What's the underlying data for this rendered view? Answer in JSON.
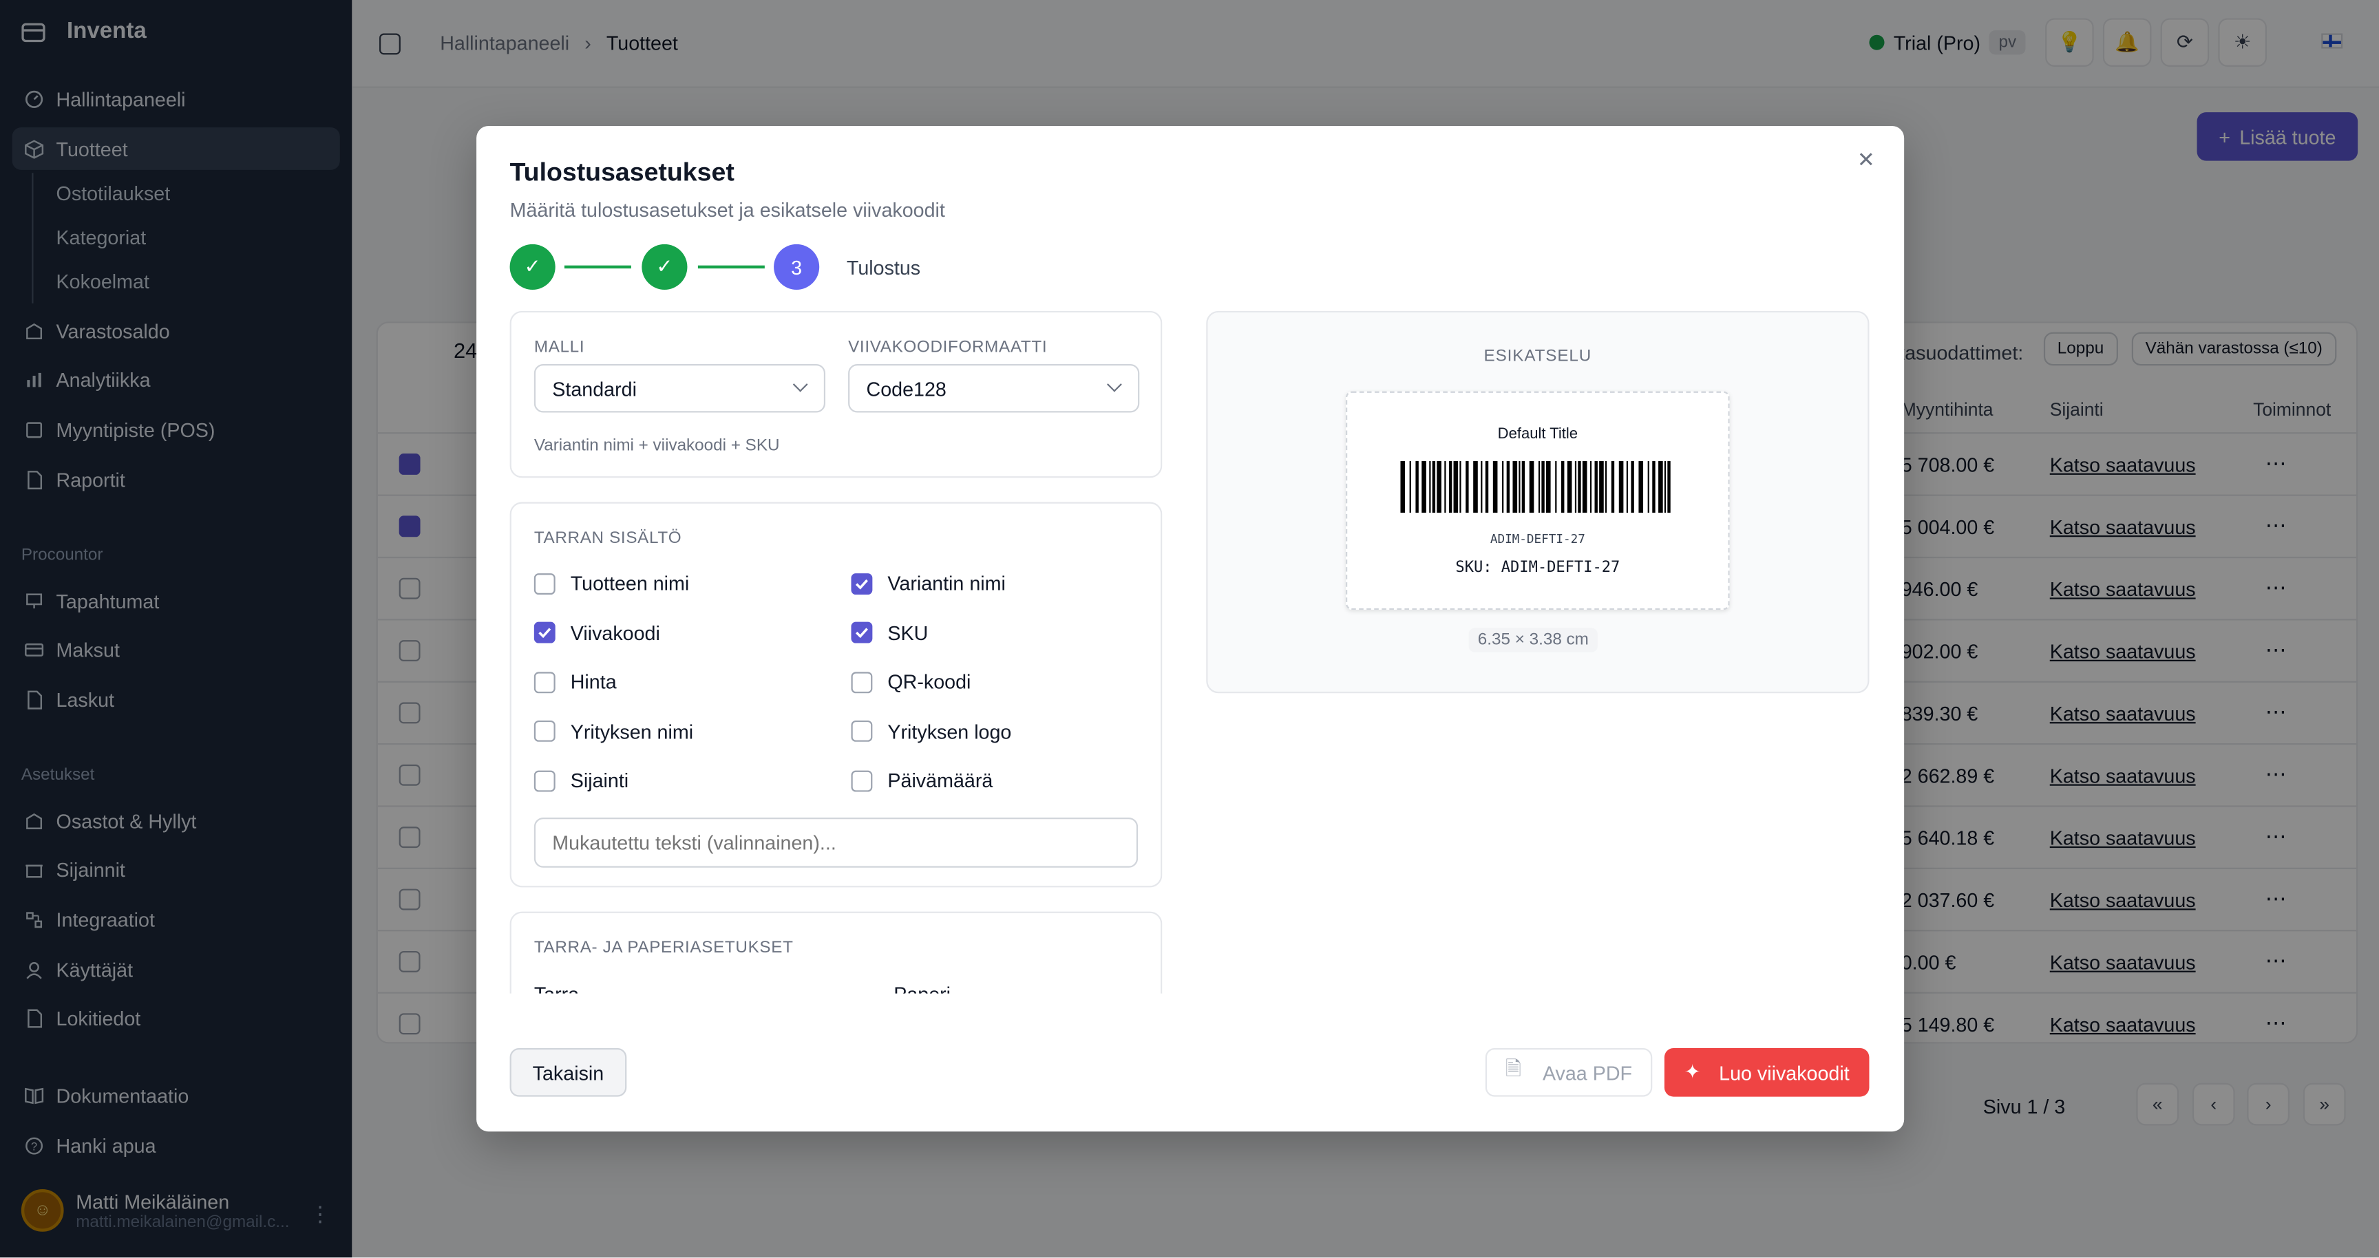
{
  "app": {
    "name": "Inventa"
  },
  "sidebar": {
    "items": [
      {
        "label": "Hallintapaneeli"
      },
      {
        "label": "Tuotteet"
      },
      {
        "label": "Varastosaldo"
      },
      {
        "label": "Analytiikka"
      },
      {
        "label": "Myyntipiste (POS)"
      },
      {
        "label": "Raportit"
      }
    ],
    "subitems": [
      {
        "label": "Ostotilaukset"
      },
      {
        "label": "Kategoriat"
      },
      {
        "label": "Kokoelmat"
      }
    ],
    "groups": [
      {
        "title": "Procountor",
        "items": [
          {
            "label": "Tapahtumat"
          },
          {
            "label": "Maksut"
          },
          {
            "label": "Laskut"
          }
        ]
      },
      {
        "title": "Asetukset",
        "items": [
          {
            "label": "Osastot & Hyllyt"
          },
          {
            "label": "Sijainnit"
          },
          {
            "label": "Integraatiot"
          },
          {
            "label": "Käyttäjät"
          },
          {
            "label": "Lokitiedot"
          }
        ]
      }
    ],
    "bottom": [
      {
        "label": "Dokumentaatio"
      },
      {
        "label": "Hanki apua"
      }
    ],
    "user": {
      "name": "Matti Meikäläinen",
      "email": "matti.meikalainen@gmail.c..."
    }
  },
  "header": {
    "breadcrumbs": [
      "Hallintapaneeli",
      "Tuotteet"
    ],
    "plan": "Trial (Pro)",
    "plan_badge": "pv"
  },
  "background": {
    "add_button": "Lisää tuote",
    "headers": {
      "price": "Myyntihinta",
      "location": "Sijainti",
      "actions": "Toiminnot"
    },
    "filters_label": "kasuodattimet:",
    "filters": [
      "Loppu",
      "Vähän varastossa (≤10)"
    ],
    "count_prefix": "24",
    "rows": [
      {
        "price": "5 708.00 €",
        "checked": true
      },
      {
        "price": "5 004.00 €",
        "checked": true
      },
      {
        "price": "946.00 €",
        "checked": false
      },
      {
        "price": "902.00 €",
        "checked": false
      },
      {
        "price": "839.30 €",
        "checked": false
      },
      {
        "price": "2 662.89 €",
        "checked": false
      },
      {
        "price": "5 640.18 €",
        "checked": false
      },
      {
        "price": "2 037.60 €",
        "checked": false
      },
      {
        "price": "0.00 €",
        "checked": false
      },
      {
        "price": "5 149.80 €",
        "checked": false
      }
    ],
    "avail_link": "Katso saatavuus",
    "pagination": "Sivu 1 / 3"
  },
  "modal": {
    "title": "Tulostusasetukset",
    "subtitle": "Määritä tulostusasetukset ja esikatsele viivakoodit",
    "steps": {
      "step3_number": "3",
      "step3_label": "Tulostus"
    },
    "template": {
      "label": "MALLI",
      "value": "Standardi",
      "hint": "Variantin nimi + viivakoodi + SKU"
    },
    "format": {
      "label": "VIIVAKOODIFORMAATTI",
      "value": "Code128"
    },
    "content": {
      "label": "TARRAN SISÄLTÖ",
      "options": [
        {
          "label": "Tuotteen nimi",
          "checked": false
        },
        {
          "label": "Variantin nimi",
          "checked": true
        },
        {
          "label": "Viivakoodi",
          "checked": true
        },
        {
          "label": "SKU",
          "checked": true
        },
        {
          "label": "Hinta",
          "checked": false
        },
        {
          "label": "QR-koodi",
          "checked": false
        },
        {
          "label": "Yrityksen nimi",
          "checked": false
        },
        {
          "label": "Yrityksen logo",
          "checked": false
        },
        {
          "label": "Sijainti",
          "checked": false
        },
        {
          "label": "Päivämäärä",
          "checked": false
        }
      ],
      "custom_placeholder": "Mukautettu teksti (valinnainen)..."
    },
    "paper": {
      "label": "TARRA- JA PAPERIASETUKSET",
      "col1": "Tarra",
      "col2": "Paperi"
    },
    "preview": {
      "title": "ESIKATSELU",
      "label_title": "Default Title",
      "barcode_text": "ADIM-DEFTI-27",
      "sku_text": "SKU: ADIM-DEFTI-27",
      "size": "6.35 × 3.38 cm"
    },
    "buttons": {
      "back": "Takaisin",
      "pdf": "Avaa PDF",
      "create": "Luo viivakoodit"
    }
  },
  "colors": {
    "accent": "#5b57d1",
    "success": "#16a34a",
    "danger": "#ef4444",
    "sidebar": "#1e293b"
  }
}
